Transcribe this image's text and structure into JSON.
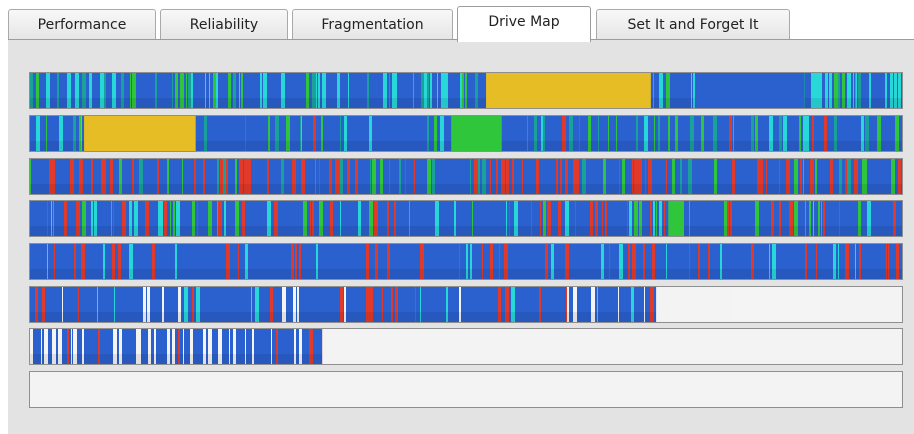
{
  "tabs": [
    {
      "label": "Performance",
      "active": false
    },
    {
      "label": "Reliability",
      "active": false
    },
    {
      "label": "Fragmentation",
      "active": false
    },
    {
      "label": "Drive Map",
      "active": true
    },
    {
      "label": "Set It and Forget It",
      "active": false
    }
  ],
  "drive_map": {
    "colors": {
      "blue": "#2b60cf",
      "cyan": "#28d8d8",
      "teal": "#1aa19a",
      "green": "#2fc63c",
      "red": "#e23a2a",
      "gold": "#e6bd24",
      "white": "#f4f4f4"
    },
    "rows": [
      {
        "fill": 1.0,
        "blocks": [
          {
            "start": 0.523,
            "end": 0.712,
            "color": "gold"
          },
          {
            "start": 0.763,
            "end": 0.888,
            "color": "blue"
          }
        ]
      },
      {
        "fill": 1.0,
        "blocks": [
          {
            "start": 0.062,
            "end": 0.19,
            "color": "gold"
          },
          {
            "start": 0.483,
            "end": 0.541,
            "color": "green"
          }
        ]
      },
      {
        "fill": 1.0,
        "blocks": []
      },
      {
        "fill": 1.0,
        "blocks": [
          {
            "start": 0.732,
            "end": 0.75,
            "color": "green"
          }
        ]
      },
      {
        "fill": 1.0,
        "blocks": []
      },
      {
        "fill": 0.718,
        "blocks": [
          {
            "start": 0.805,
            "end": 0.905,
            "color": "white"
          }
        ]
      },
      {
        "fill": 0.335,
        "blocks": []
      },
      {
        "fill": 0.0,
        "blocks": []
      }
    ]
  }
}
